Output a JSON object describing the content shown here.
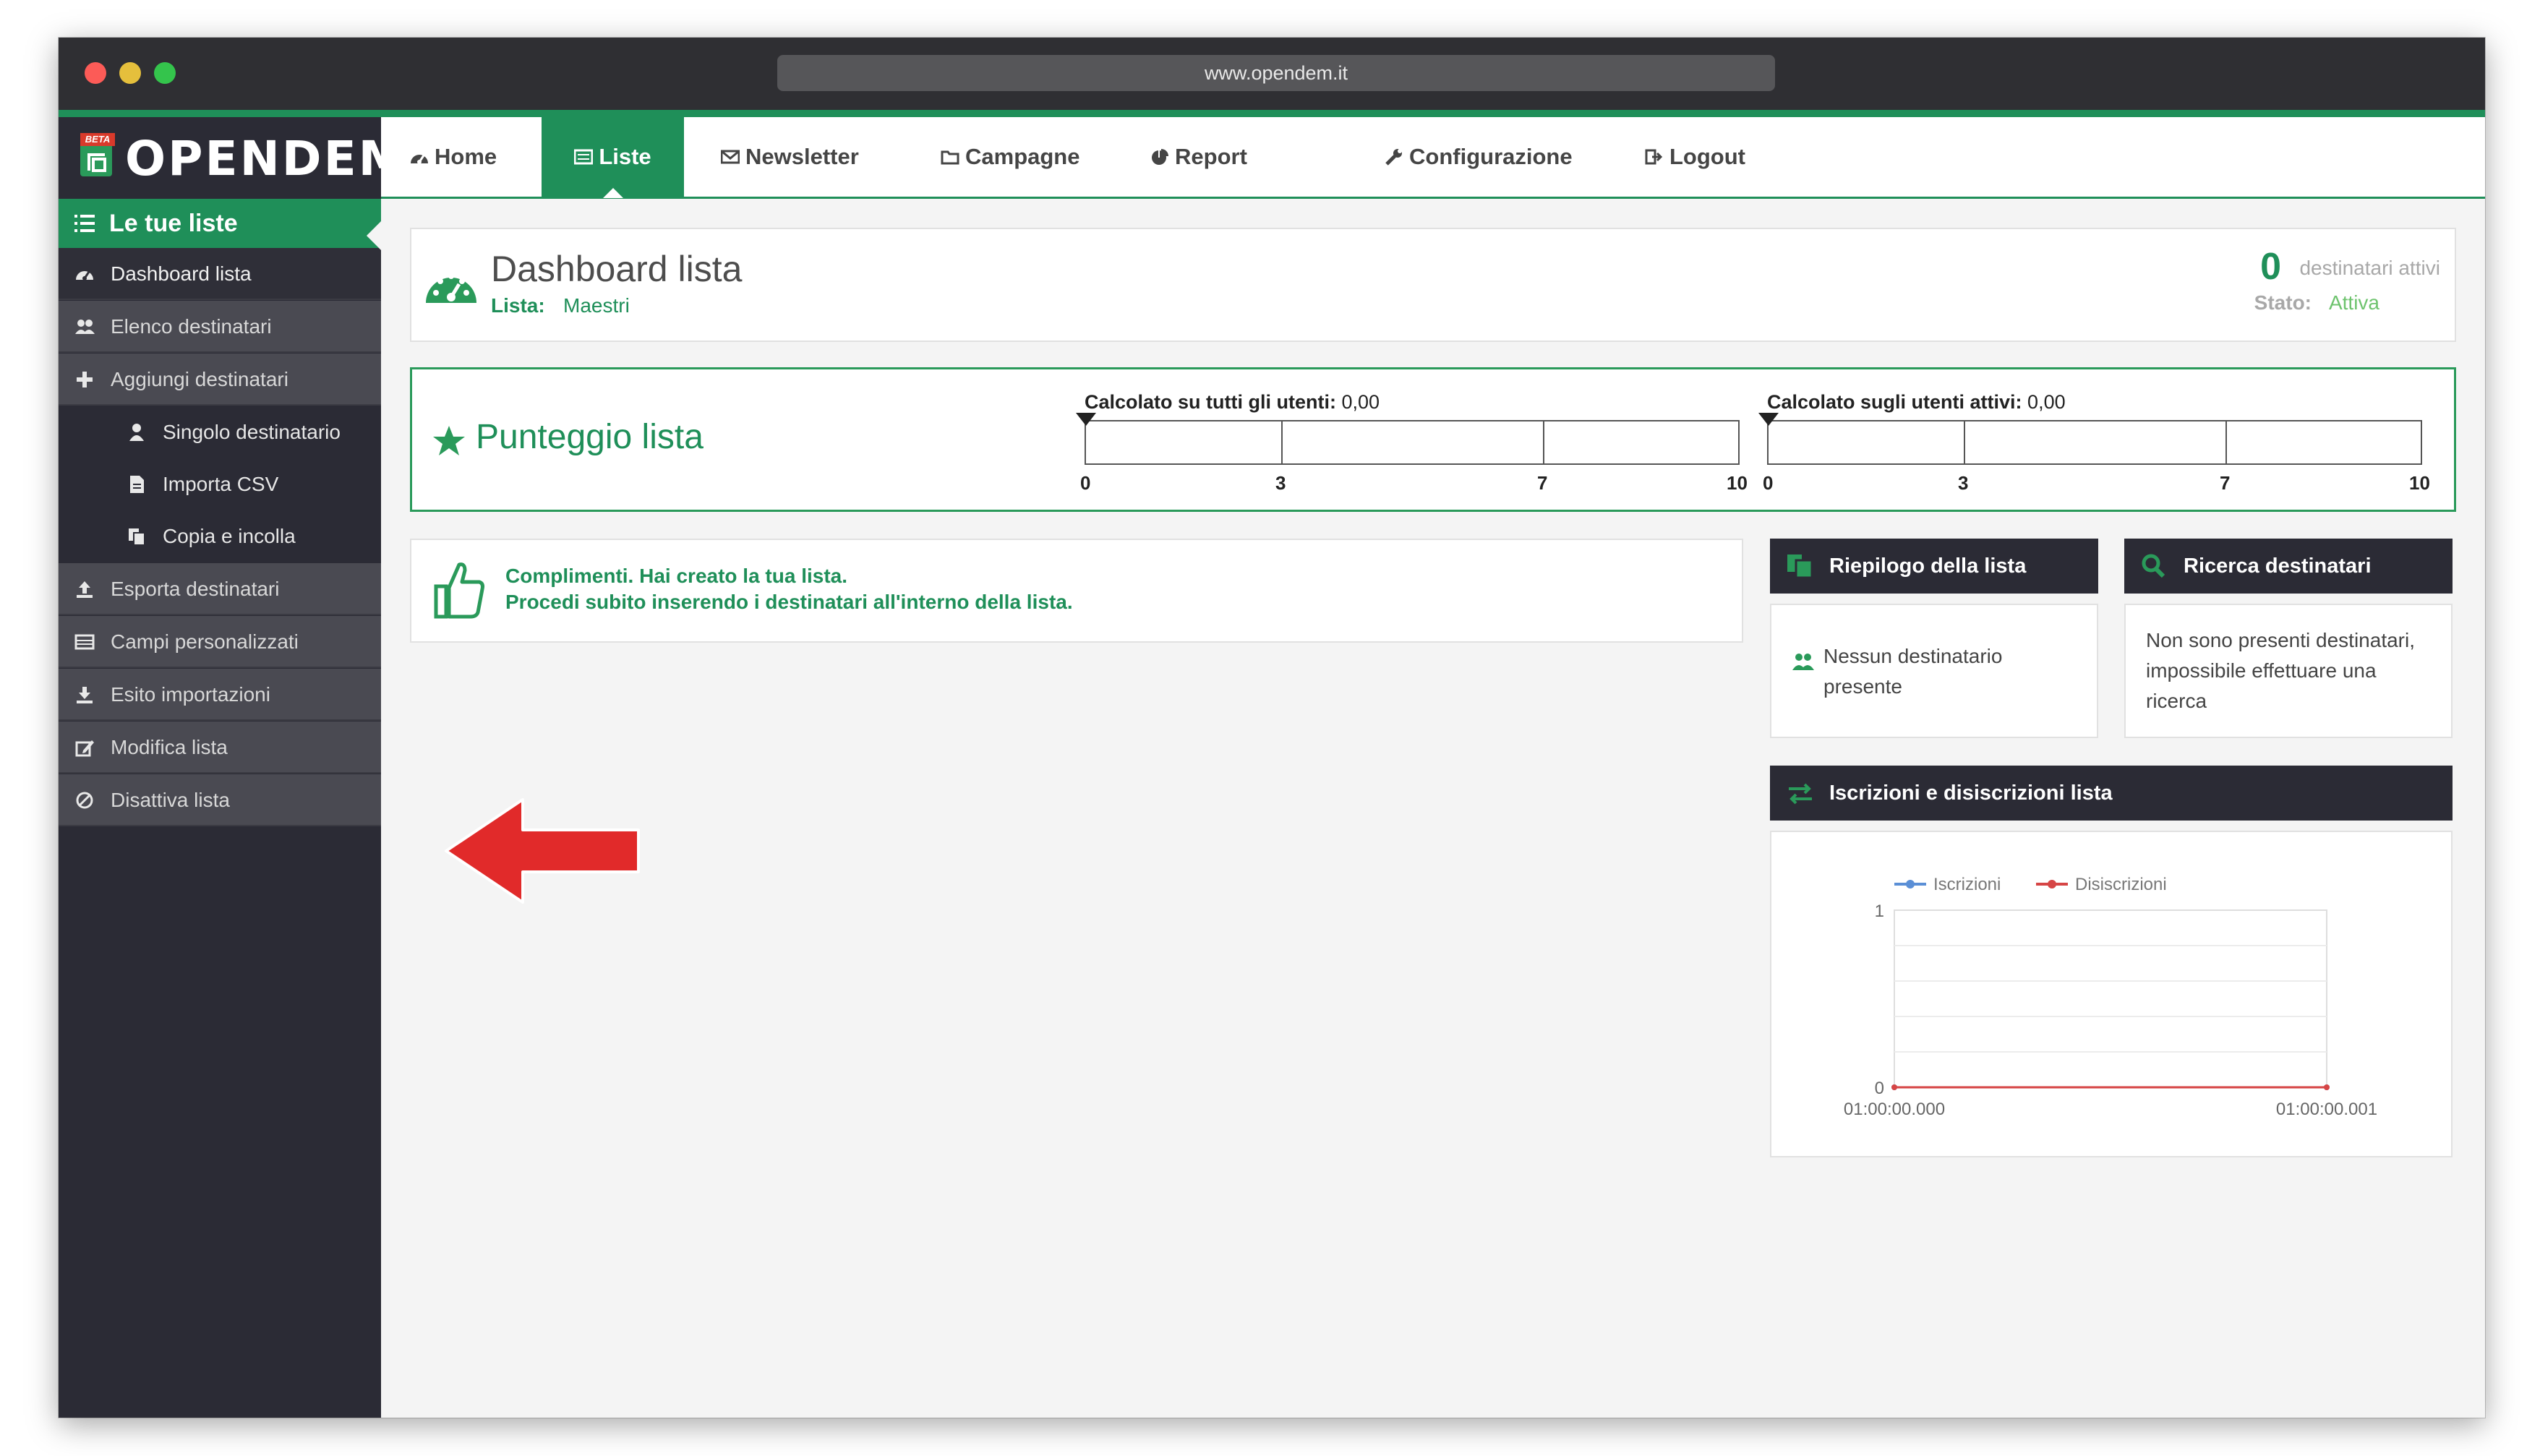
{
  "browser": {
    "url": "www.opendem.it"
  },
  "brand": {
    "logo_text": "OPENDEM",
    "badge": "BETA",
    "accent": "#1f8f59",
    "dark": "#2b2b35"
  },
  "nav": {
    "items": [
      {
        "label": "Home",
        "icon": "dashboard-icon"
      },
      {
        "label": "Liste",
        "icon": "list-icon",
        "active": true
      },
      {
        "label": "Newsletter",
        "icon": "envelope-icon"
      },
      {
        "label": "Campagne",
        "icon": "folder-icon"
      },
      {
        "label": "Report",
        "icon": "pie-chart-icon"
      },
      {
        "label": "Configurazione",
        "icon": "wrench-icon"
      },
      {
        "label": "Logout",
        "icon": "logout-icon"
      }
    ]
  },
  "sidebar": {
    "header": "Le tue liste",
    "items": [
      {
        "label": "Dashboard lista",
        "icon": "dashboard-icon",
        "active": true
      },
      {
        "label": "Elenco destinatari",
        "icon": "users-icon"
      },
      {
        "label": "Aggiungi destinatari",
        "icon": "plus-icon"
      },
      {
        "label": "Singolo destinatario",
        "icon": "user-icon",
        "sub": true
      },
      {
        "label": "Importa CSV",
        "icon": "file-icon",
        "sub": true
      },
      {
        "label": "Copia e incolla",
        "icon": "copy-icon",
        "sub": true
      },
      {
        "label": "Esporta destinatari",
        "icon": "upload-icon"
      },
      {
        "label": "Campi personalizzati",
        "icon": "table-icon"
      },
      {
        "label": "Esito importazioni",
        "icon": "download-icon"
      },
      {
        "label": "Modifica lista",
        "icon": "edit-icon"
      },
      {
        "label": "Disattiva lista",
        "icon": "ban-icon"
      }
    ]
  },
  "dashboard": {
    "title": "Dashboard lista",
    "lista_label": "Lista:",
    "lista_value": "Maestri",
    "active_count": "0",
    "active_label": "destinatari attivi",
    "stato_label": "Stato:",
    "stato_value": "Attiva"
  },
  "score": {
    "title": "Punteggio lista",
    "scales": [
      {
        "label": "Calcolato su tutti gli utenti:",
        "value": "0,00",
        "score": 0,
        "ticks": [
          "0",
          "3",
          "7",
          "10"
        ]
      },
      {
        "label": "Calcolato sugli utenti attivi:",
        "value": "0,00",
        "score": 0,
        "ticks": [
          "0",
          "3",
          "7",
          "10"
        ]
      }
    ]
  },
  "info": {
    "line1": "Complimenti. Hai creato la tua lista.",
    "line2": "Procedi subito inserendo i destinatari all'interno della lista."
  },
  "riepilogo": {
    "title": "Riepilogo della lista",
    "text": "Nessun destinatario presente"
  },
  "ricerca": {
    "title": "Ricerca destinatari",
    "text": "Non sono presenti destinatari, impossibile effettuare una ricerca"
  },
  "iscrizioni": {
    "title": "Iscrizioni e disiscrizioni lista"
  },
  "chart_data": {
    "type": "line",
    "x": [
      "01:00:00.000",
      "01:00:00.001"
    ],
    "series": [
      {
        "name": "Iscrizioni",
        "color": "#5b8fd6",
        "values": [
          0,
          0
        ]
      },
      {
        "name": "Disiscrizioni",
        "color": "#d64545",
        "values": [
          0,
          0
        ]
      }
    ],
    "ylim": [
      0,
      1
    ],
    "yticks": [
      "0",
      "1"
    ],
    "grid": true,
    "legend": "top"
  }
}
